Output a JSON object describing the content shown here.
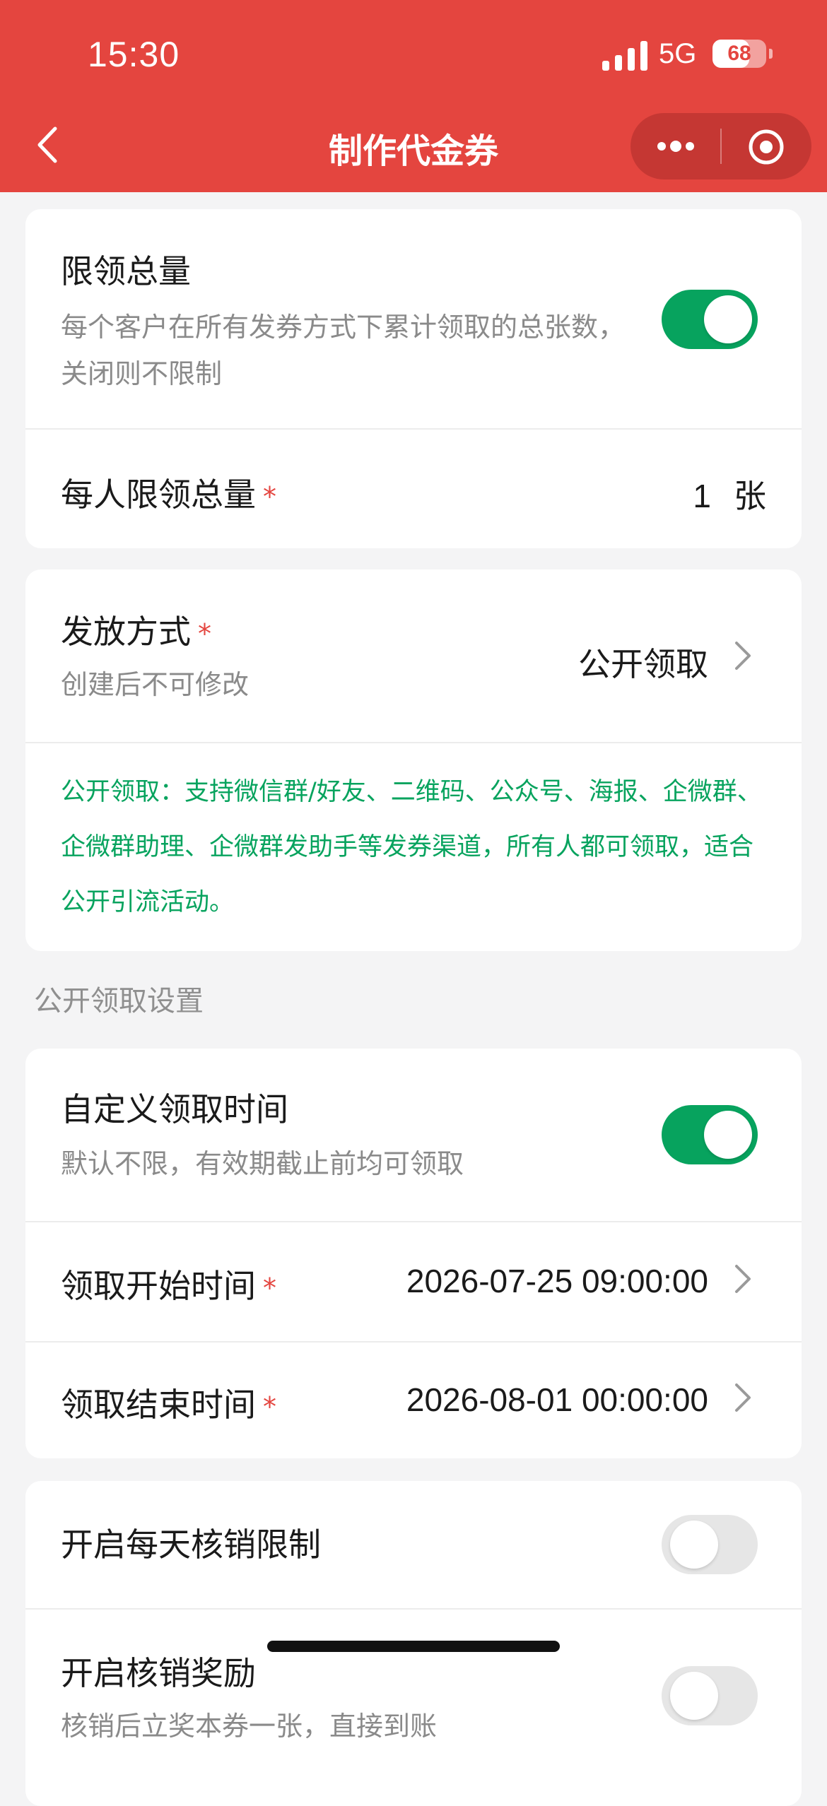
{
  "status_bar": {
    "time": "15:30",
    "network": "5G",
    "battery": 68
  },
  "nav": {
    "title": "制作代金券"
  },
  "colors": {
    "brand_red": "#e4453f",
    "switch_on": "#07a35e",
    "info_green": "#07a35e"
  },
  "limit_card": {
    "total_limit_label": "限领总量",
    "total_limit_desc": "每个客户在所有发券方式下累计领取的总张数，关闭则不限制",
    "total_limit_on": true,
    "per_person_label": "每人限领总量",
    "required_mark": "*",
    "per_person_value": "1",
    "per_person_unit": "张"
  },
  "issue_card": {
    "method_label": "发放方式",
    "required_mark": "*",
    "method_desc": "创建后不可修改",
    "method_value": "公开领取",
    "method_info": "公开领取：支持微信群/好友、二维码、公众号、海报、企微群、企微群助理、企微群发助手等发券渠道，所有人都可领取，适合公开引流活动。"
  },
  "section": {
    "title": "公开领取设置"
  },
  "time_card": {
    "custom_time_label": "自定义领取时间",
    "custom_time_desc": "默认不限，有效期截止前均可领取",
    "custom_time_on": true,
    "start_label": "领取开始时间",
    "start_value": "2026-07-25 09:00:00",
    "end_label": "领取结束时间",
    "end_value": "2026-08-01 00:00:00",
    "required_mark": "*"
  },
  "redeem_card": {
    "daily_limit_label": "开启每天核销限制",
    "daily_limit_on": false,
    "reward_label": "开启核销奖励",
    "reward_desc": "核销后立奖本券一张，直接到账",
    "reward_on": false
  },
  "icons": {
    "back": "chevron-left-icon",
    "more": "more-dots-icon",
    "close": "capsule-close-icon",
    "row_chevron": "chevron-right-icon"
  }
}
